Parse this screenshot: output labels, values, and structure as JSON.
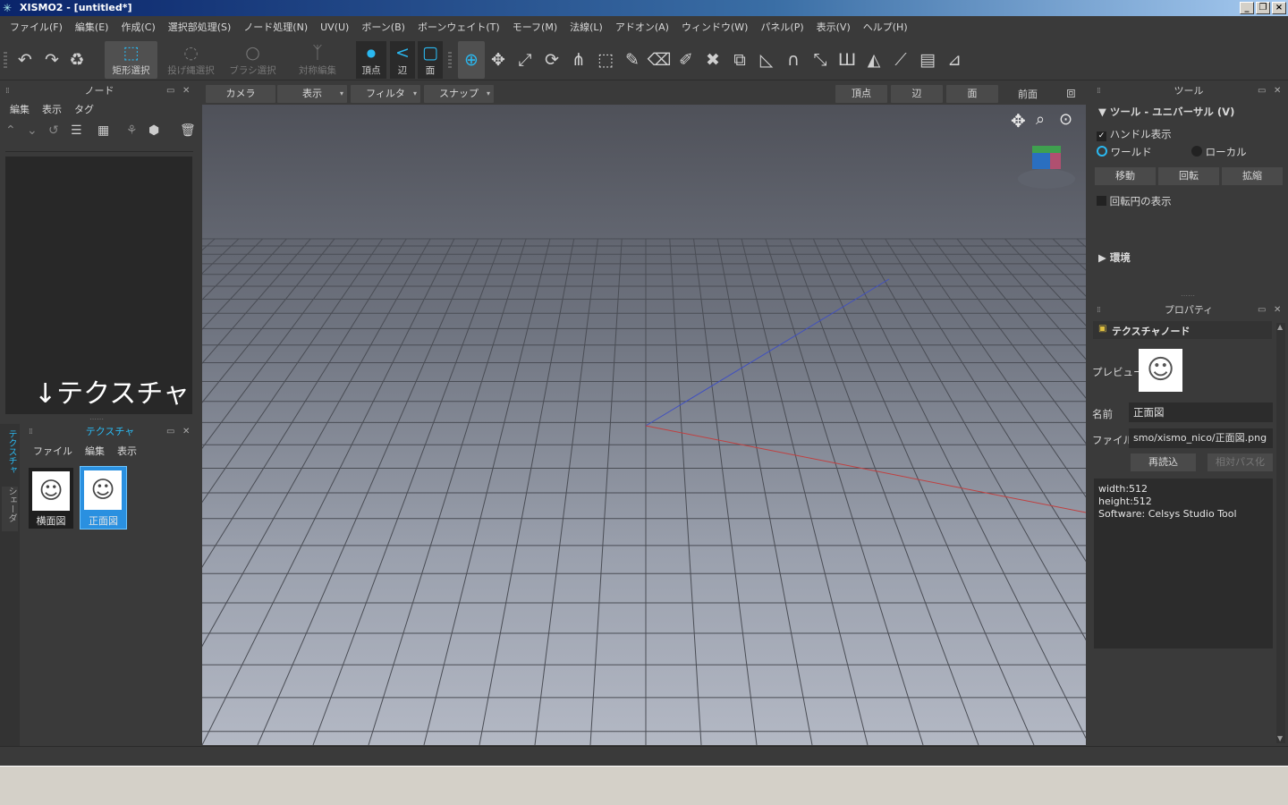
{
  "window": {
    "title": "XISMO2 - [untitled*]"
  },
  "menu": [
    "ファイル(F)",
    "編集(E)",
    "作成(C)",
    "選択部処理(S)",
    "ノード処理(N)",
    "UV(U)",
    "ボーン(B)",
    "ボーンウェイト(T)",
    "モーフ(M)",
    "法線(L)",
    "アドオン(A)",
    "ウィンドウ(W)",
    "パネル(P)",
    "表示(V)",
    "ヘルプ(H)"
  ],
  "toolbar": {
    "rect_select": "矩形選択",
    "lasso_select": "投げ縄選択",
    "brush_select": "ブラシ選択",
    "symmetric_edit": "対称編集",
    "vertex": "頂点",
    "edge": "辺",
    "face": "面"
  },
  "node_panel": {
    "title": "ノード",
    "menu": [
      "編集",
      "表示",
      "タグ"
    ],
    "annotation": "↓テクスチャ"
  },
  "texture_panel": {
    "title": "テクスチャ",
    "menu": [
      "ファイル",
      "編集",
      "表示"
    ],
    "items": [
      {
        "label": "横面図",
        "selected": false
      },
      {
        "label": "正面図",
        "selected": true
      }
    ],
    "side_tabs": [
      "テクスチャ",
      "シェーダ"
    ]
  },
  "viewport_bar": {
    "camera": "カメラ",
    "display": "表示",
    "filter": "フィルタ",
    "snap": "スナップ",
    "vertex": "頂点",
    "edge": "辺",
    "face": "面",
    "view_name": "前面"
  },
  "tool_panel": {
    "title": "ツール",
    "section": "ツール - ユニバーサル (V)",
    "show_handle": "ハンドル表示",
    "show_handle_checked": true,
    "world": "ワールド",
    "local": "ローカル",
    "coord_mode": "world",
    "move": "移動",
    "rotate": "回転",
    "scale": "拡縮",
    "show_rotation_circle": "回転円の表示",
    "show_rotation_circle_checked": false,
    "environment": "環境"
  },
  "property_panel": {
    "title": "プロパティ",
    "node_type": "テクスチャノード",
    "preview_label": "プレビュー",
    "name_label": "名前",
    "name_value": "正面図",
    "file_label": "ファイル",
    "file_value": "smo/xismo_nico/正面図.png",
    "reload": "再読込",
    "relative_path": "相対パス化",
    "info": [
      "width:512",
      "height:512",
      "Software: Celsys Studio Tool"
    ]
  },
  "colors": {
    "accent": "#2ab8f0",
    "panel_bg": "#3a3a3a",
    "viewport_top": "#4f5159",
    "viewport_bottom": "#b3b8c4",
    "axis_x": "#c04040",
    "axis_z": "#4050c0"
  }
}
